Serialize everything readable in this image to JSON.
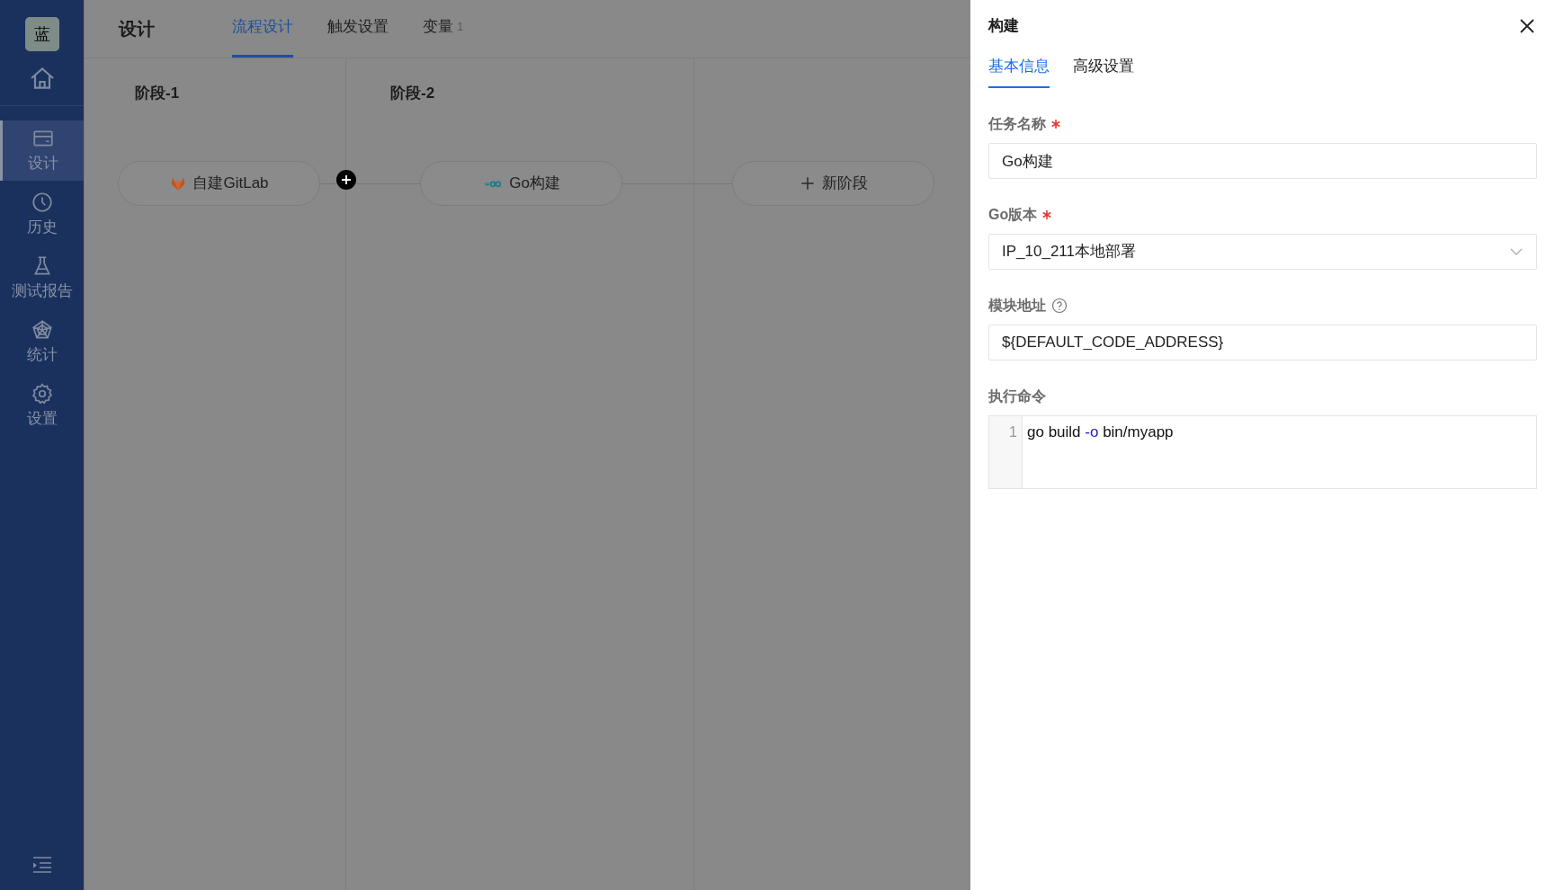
{
  "sidebar": {
    "logo": "蓝",
    "items": [
      {
        "label": "设计",
        "selected": true
      },
      {
        "label": "历史",
        "selected": false
      },
      {
        "label": "测试报告",
        "selected": false
      },
      {
        "label": "统计",
        "selected": false
      },
      {
        "label": "设置",
        "selected": false
      }
    ]
  },
  "header": {
    "title": "设计",
    "tabs": [
      {
        "label": "流程设计",
        "selected": true
      },
      {
        "label": "触发设置",
        "selected": false
      },
      {
        "label": "变量",
        "count": "1",
        "selected": false
      }
    ]
  },
  "stages": [
    {
      "title": "阶段-1",
      "task": {
        "label": "自建GitLab",
        "kind": "gitlab"
      }
    },
    {
      "title": "阶段-2",
      "task": {
        "label": "Go构建",
        "kind": "go"
      }
    },
    {
      "task": {
        "label": "新阶段",
        "kind": "add"
      }
    }
  ],
  "drawer": {
    "title": "构建",
    "tabs": [
      {
        "label": "基本信息",
        "selected": true
      },
      {
        "label": "高级设置",
        "selected": false
      }
    ],
    "fields": [
      {
        "label": "任务名称",
        "required": true,
        "kind": "input",
        "value": "Go构建"
      },
      {
        "label": "Go版本",
        "required": true,
        "kind": "select",
        "value": "IP_10_211本地部署"
      },
      {
        "label": "模块地址",
        "required": false,
        "help": true,
        "kind": "input",
        "value": "${DEFAULT_CODE_ADDRESS}"
      },
      {
        "label": "执行命令",
        "required": false,
        "kind": "code",
        "lines": [
          {
            "number": "1",
            "tokens": [
              {
                "text": "go build ",
                "kind": "plain"
              },
              {
                "text": "-o",
                "kind": "flag"
              },
              {
                "text": " bin/myapp",
                "kind": "plain"
              }
            ]
          }
        ]
      }
    ]
  }
}
